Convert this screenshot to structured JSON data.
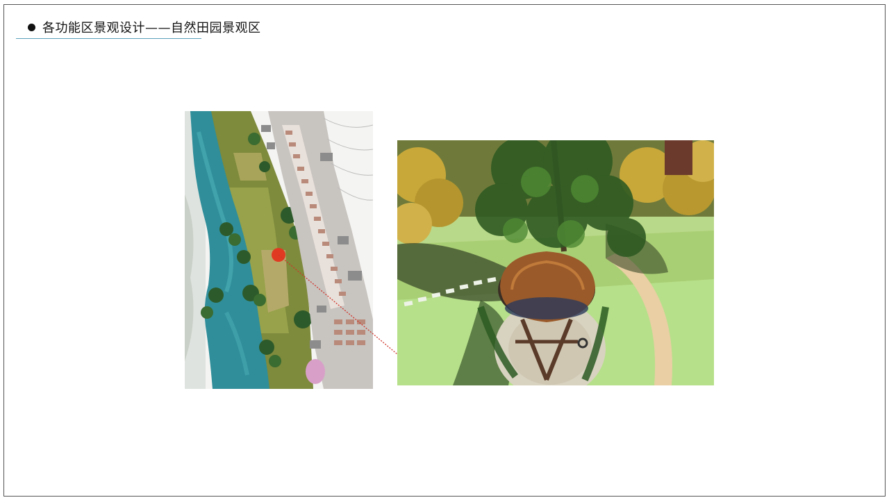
{
  "slide": {
    "title": "各功能区景观设计——自然田园景观区"
  },
  "images": {
    "site_plan": {
      "description_icon": "aerial-site-plan-image"
    },
    "render": {
      "description_icon": "treehouse-render-image"
    }
  },
  "colors": {
    "title_text": "#111111",
    "title_rule": "#5aa0b8",
    "marker": "#e03a22",
    "leader_line": "#d0342a",
    "frame_border": "#555555"
  }
}
